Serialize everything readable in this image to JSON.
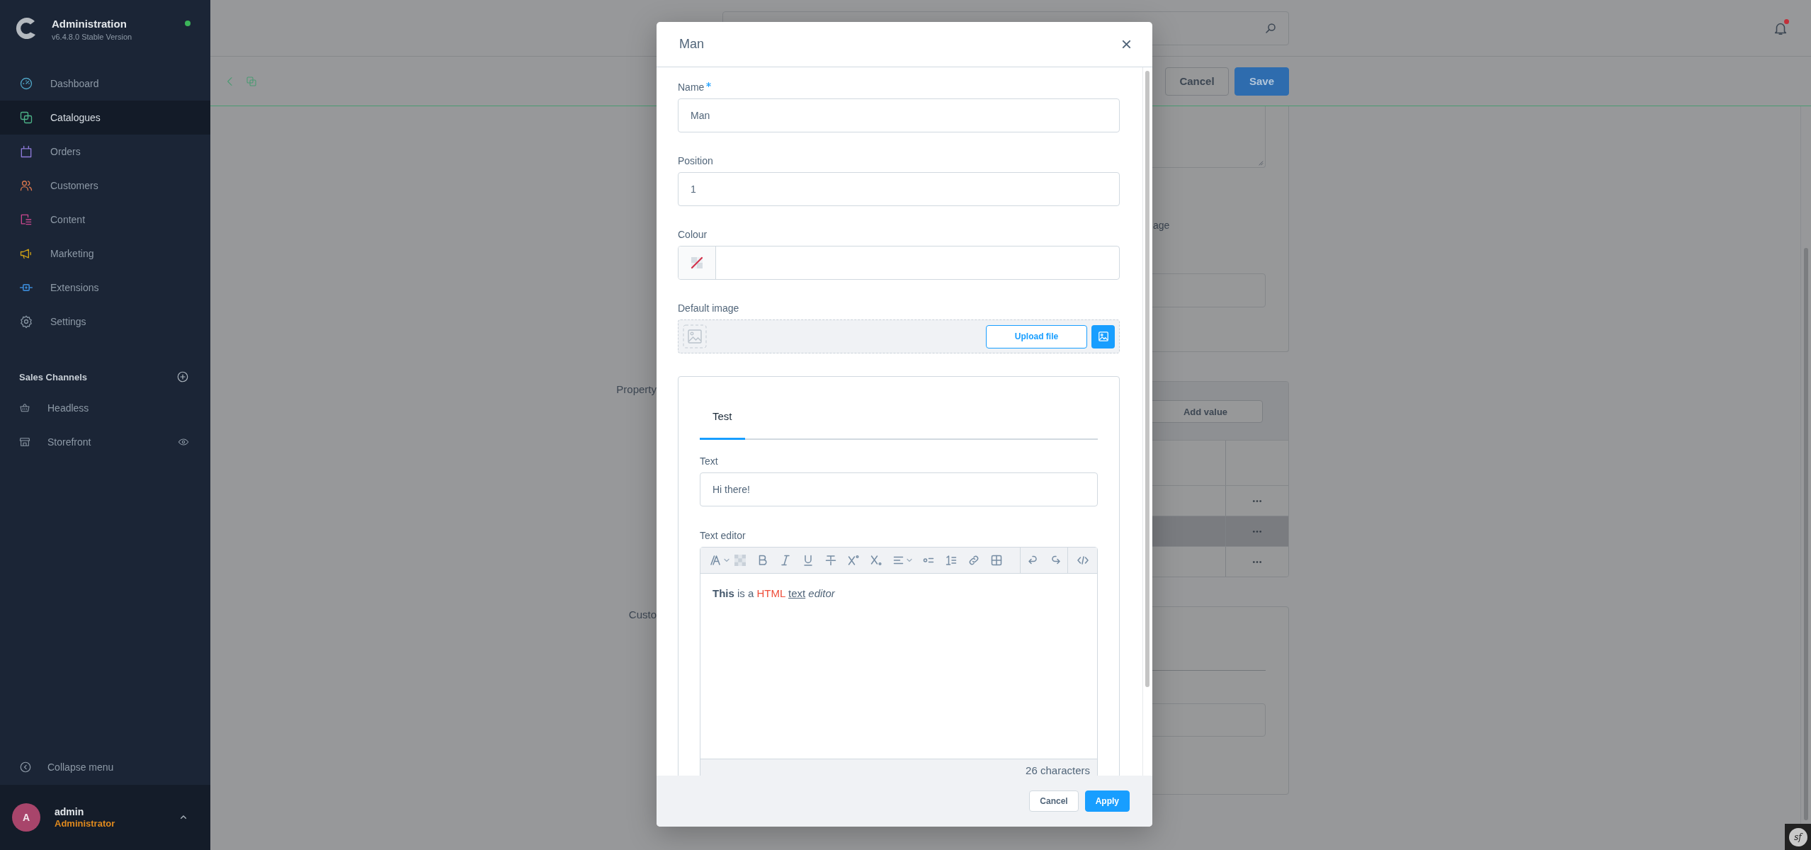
{
  "sidebar": {
    "brand": {
      "title": "Administration",
      "version": "v6.4.8.0 Stable Version",
      "online": true
    },
    "nav": [
      {
        "label": "Dashboard",
        "color": "#4fa3c4",
        "selected": false
      },
      {
        "label": "Catalogues",
        "color": "#4db388",
        "selected": true
      },
      {
        "label": "Orders",
        "color": "#8d7ad8",
        "selected": false
      },
      {
        "label": "Customers",
        "color": "#d9774e",
        "selected": false
      },
      {
        "label": "Content",
        "color": "#c9478f",
        "selected": false
      },
      {
        "label": "Marketing",
        "color": "#cfa215",
        "selected": false
      },
      {
        "label": "Extensions",
        "color": "#3a86d1",
        "selected": false
      },
      {
        "label": "Settings",
        "color": "#8593a1",
        "selected": false
      }
    ],
    "sales_channels": {
      "title": "Sales Channels",
      "items": [
        {
          "label": "Headless",
          "kind": "headless"
        },
        {
          "label": "Storefront",
          "kind": "storefront"
        }
      ]
    },
    "collapse_label": "Collapse menu",
    "user": {
      "initial": "A",
      "name": "admin",
      "role": "Administrator"
    }
  },
  "topbar": {
    "notifications_unread": true
  },
  "actions": [
    {
      "label": "Cancel",
      "kind": "secondary"
    },
    {
      "label": "Save",
      "kind": "primary"
    }
  ],
  "general_card": {
    "label_fragment": "age"
  },
  "values_card": {
    "title": "Property",
    "add_label": "Add value",
    "rows": [
      {
        "selected": false
      },
      {
        "selected": true
      },
      {
        "selected": false
      }
    ]
  },
  "custom_card": {
    "title": "Custo"
  },
  "modal": {
    "title": "Man",
    "fields": [
      {
        "kind": "text",
        "label": "Name",
        "required": true,
        "value": "Man"
      },
      {
        "kind": "text",
        "label": "Position",
        "required": false,
        "value": "1"
      },
      {
        "kind": "color",
        "label": "Colour",
        "required": false
      },
      {
        "kind": "image",
        "label": "Default image",
        "required": false,
        "button": "Upload file"
      }
    ],
    "custom_fields": {
      "tabs": [
        {
          "label": "Test",
          "selected": true
        }
      ],
      "fields": [
        {
          "kind": "text",
          "label": "Text",
          "value": "Hi there!"
        },
        {
          "kind": "editor",
          "label": "Text editor",
          "content": [
            {
              "text": "This",
              "kind": "strong",
              "color": "#44576b"
            },
            {
              "text": "is a",
              "kind": "plain",
              "color": "#52667a"
            },
            {
              "text": "HTML",
              "kind": "plain",
              "color": "#ef4e3a"
            },
            {
              "text": "text",
              "kind": "underlined",
              "color": "#52667a"
            },
            {
              "text": "editor",
              "kind": "emphasis",
              "color": "#52667a"
            }
          ],
          "counter": "26 characters"
        }
      ]
    },
    "buttons": [
      {
        "label": "Cancel",
        "kind": "secondary"
      },
      {
        "label": "Apply",
        "kind": "primary"
      }
    ]
  },
  "debug_toolbar": {
    "label": "sf"
  }
}
